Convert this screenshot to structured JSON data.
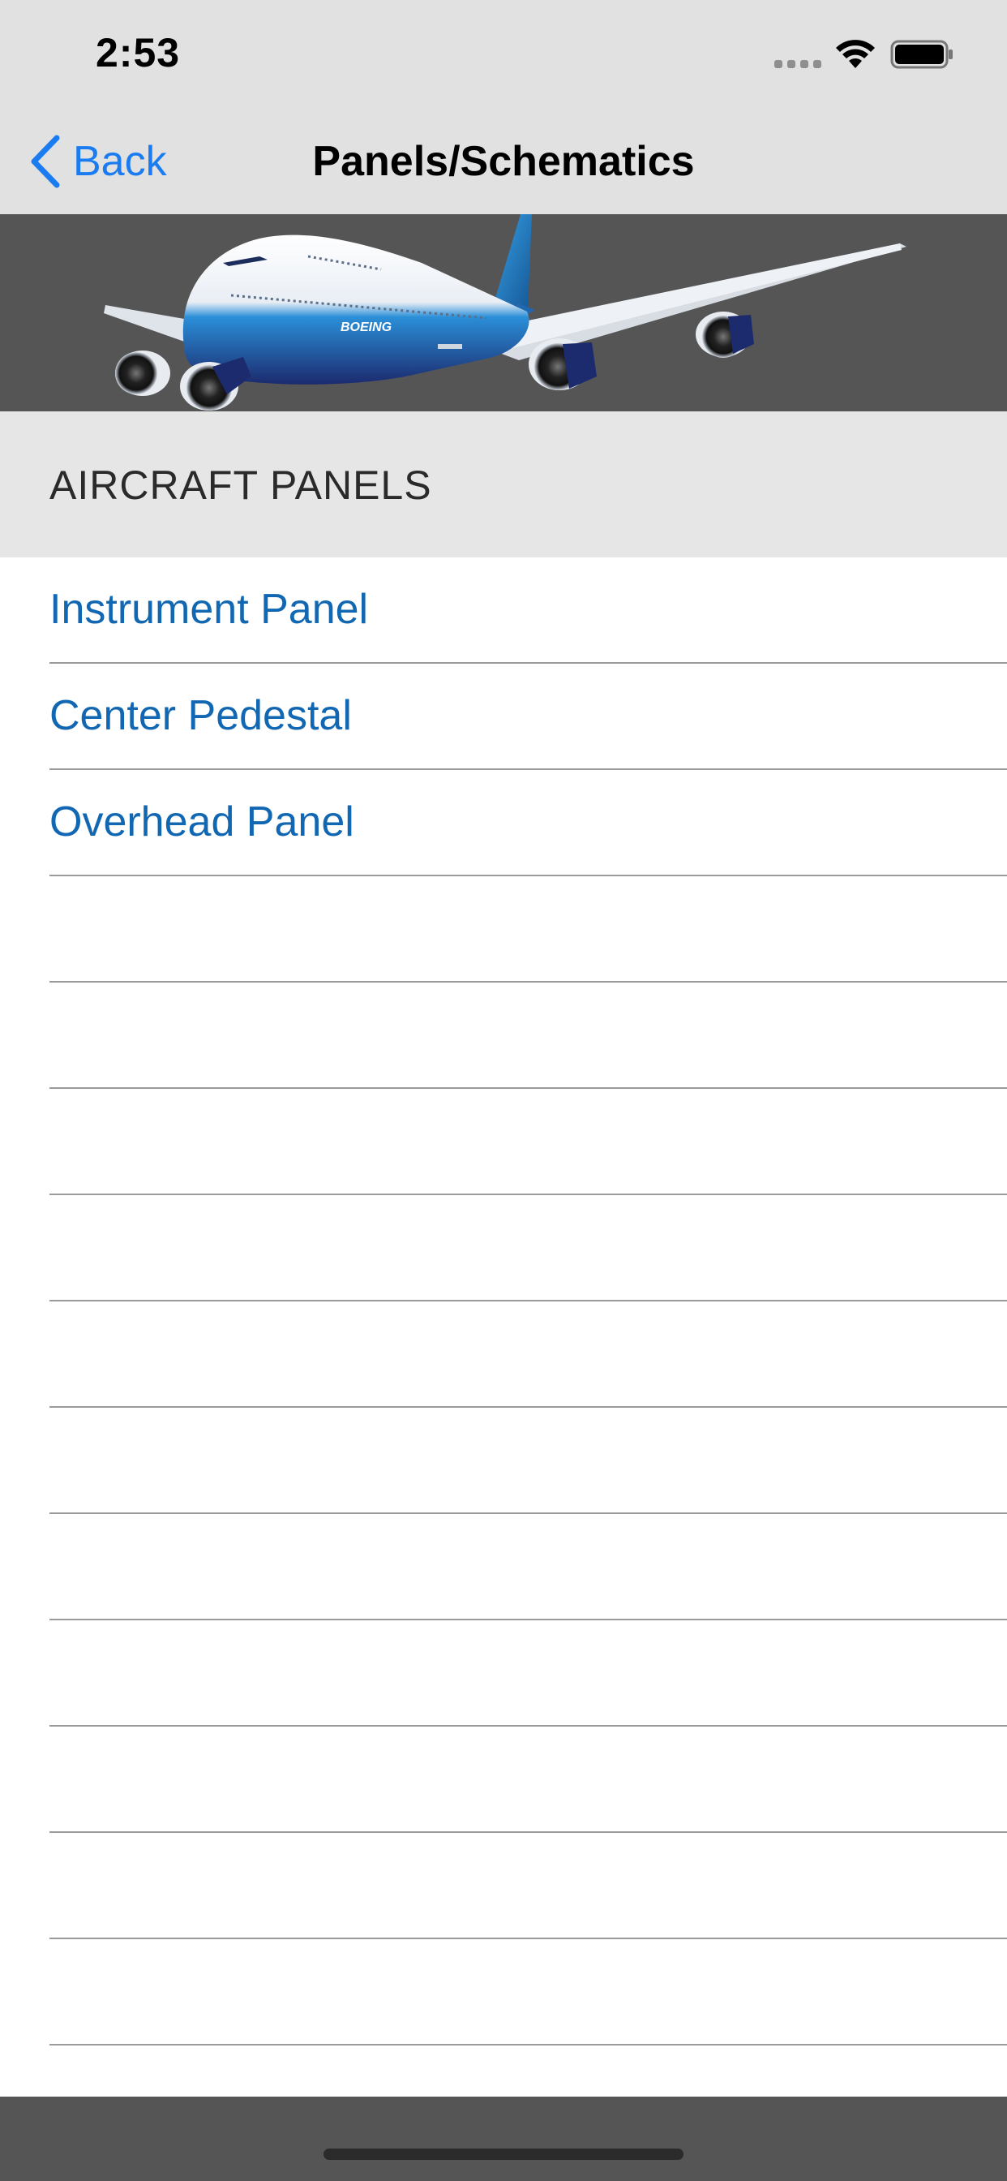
{
  "status_bar": {
    "time": "2:53"
  },
  "nav": {
    "back_label": "Back",
    "title": "Panels/Schematics"
  },
  "banner": {
    "logo_text": "BOEING"
  },
  "section": {
    "title": "AIRCRAFT PANELS"
  },
  "list": {
    "items": [
      {
        "label": "Instrument Panel"
      },
      {
        "label": "Center Pedestal"
      },
      {
        "label": "Overhead Panel"
      },
      {
        "label": ""
      },
      {
        "label": ""
      },
      {
        "label": ""
      },
      {
        "label": ""
      },
      {
        "label": ""
      },
      {
        "label": ""
      },
      {
        "label": ""
      },
      {
        "label": ""
      },
      {
        "label": ""
      },
      {
        "label": ""
      },
      {
        "label": ""
      }
    ]
  },
  "colors": {
    "accent": "#1a7cf0",
    "link": "#1267b3",
    "bar_background": "#e1e1e1",
    "banner_background": "#555555"
  }
}
